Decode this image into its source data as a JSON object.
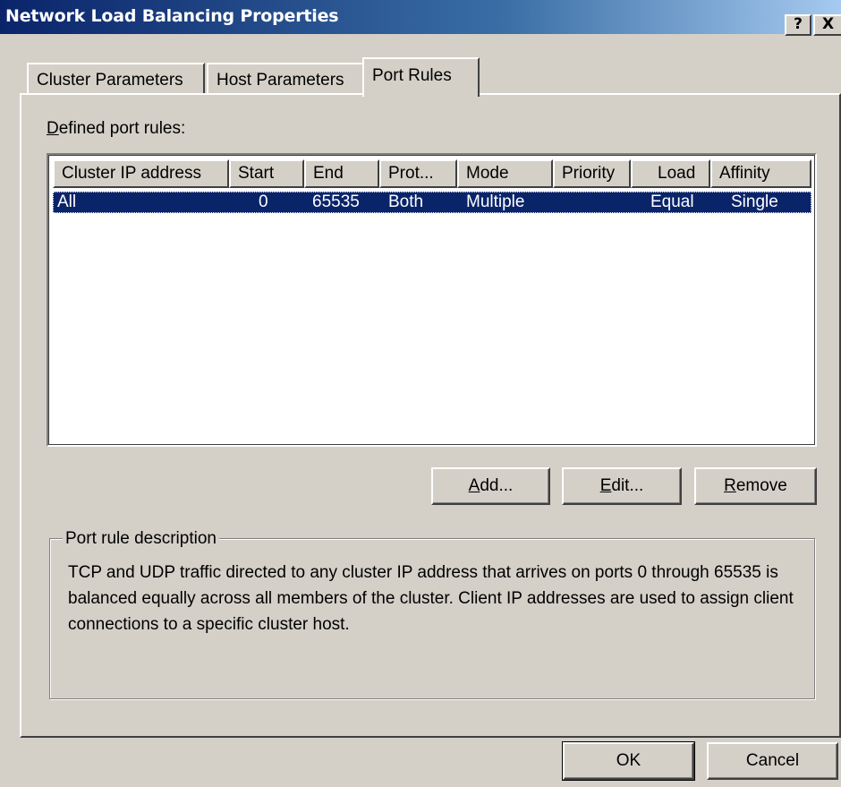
{
  "window": {
    "title": "Network Load Balancing Properties",
    "help_label": "?",
    "close_label": "X"
  },
  "tabs": [
    {
      "label": "Cluster Parameters",
      "active": false
    },
    {
      "label": "Host Parameters",
      "active": false
    },
    {
      "label": "Port Rules",
      "active": true
    }
  ],
  "port_rules": {
    "label_mnemonic": "D",
    "label_rest": "efined port rules:",
    "columns": [
      "Cluster IP address",
      "Start",
      "End",
      "Prot...",
      "Mode",
      "Priority",
      "Load",
      "Affinity"
    ],
    "rows": [
      {
        "cluster_ip": "All",
        "start": "0",
        "end": "65535",
        "protocol": "Both",
        "mode": "Multiple",
        "priority": "",
        "load": "Equal",
        "affinity": "Single",
        "selected": true
      }
    ]
  },
  "buttons": {
    "add": {
      "mnemonic": "A",
      "rest": "dd..."
    },
    "edit": {
      "mnemonic": "E",
      "rest": "dit..."
    },
    "remove": {
      "mnemonic": "R",
      "rest": "emove"
    },
    "ok": "OK",
    "cancel": "Cancel"
  },
  "description": {
    "legend": "Port rule description",
    "text": "TCP and UDP traffic directed to any cluster IP address that arrives on ports 0 through 65535 is balanced equally across all members of the cluster.  Client IP addresses are used to assign client connections to a specific cluster host."
  },
  "colors": {
    "face": "#d4d0c8",
    "selection": "#0a246a",
    "title_start": "#0a246a",
    "title_end": "#a6caf0"
  }
}
